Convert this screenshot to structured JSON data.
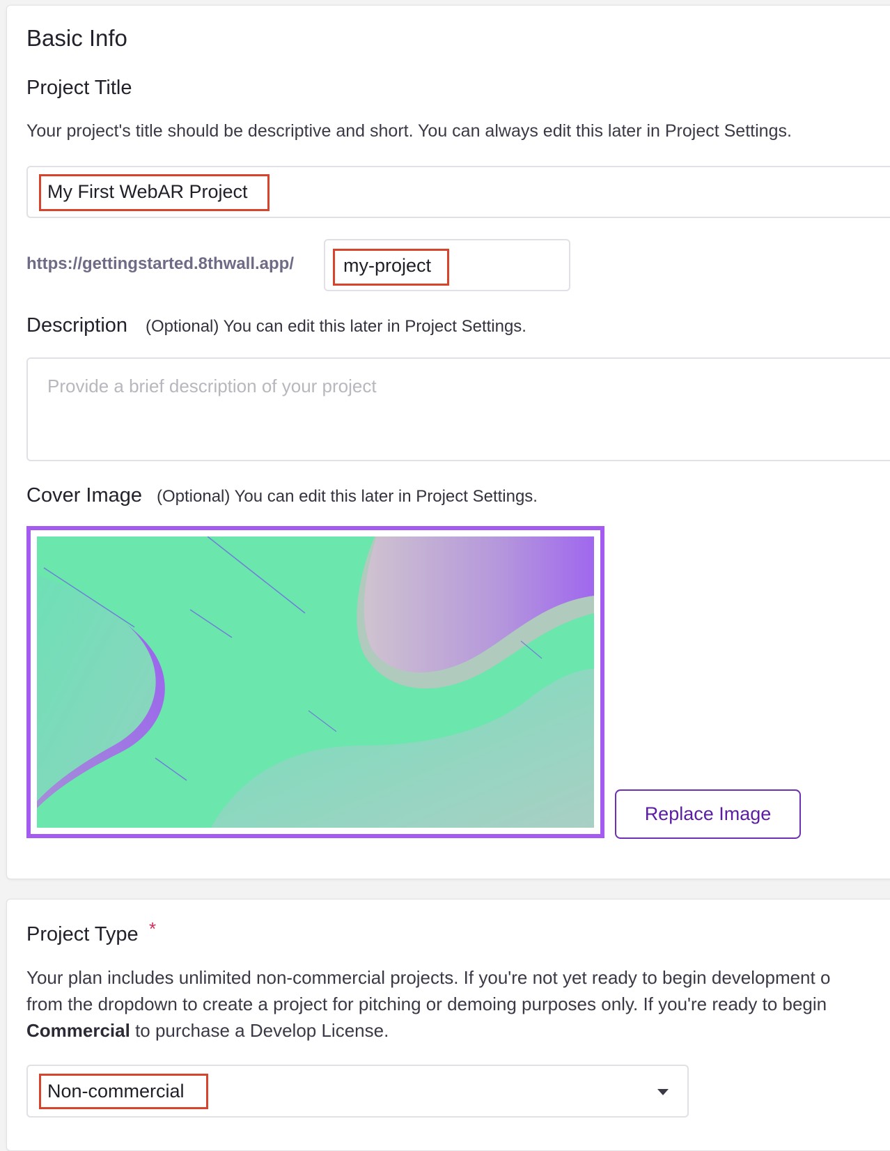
{
  "basic_info": {
    "section_title": "Basic Info",
    "project_title_label": "Project Title",
    "project_title_help": "Your project's title should be descriptive and short. You can always edit this later in Project Settings.",
    "project_title_value": "My First WebAR Project",
    "url_prefix": "https://gettingstarted.8thwall.app/",
    "url_slug_value": "my-project",
    "description_label": "Description",
    "description_optional": "(Optional) You can edit this later in Project Settings.",
    "description_placeholder": "Provide a brief description of your project",
    "cover_image_label": "Cover Image",
    "cover_image_optional": "(Optional) You can edit this later in Project Settings.",
    "replace_image_label": "Replace Image"
  },
  "project_type": {
    "label": "Project Type",
    "required_mark": "*",
    "help_line1": "Your plan includes unlimited non-commercial projects. If you're not yet ready to begin development o",
    "help_line2": "from the dropdown to create a project for pitching or demoing purposes only. If you're ready to begin",
    "help_bold": "Commercial",
    "help_line3_rest": " to purchase a Develop License.",
    "selected_value": "Non-commercial"
  },
  "colors": {
    "accent_purple": "#a45bf0",
    "button_purple": "#5b1ea3",
    "highlight_red": "#d8432c",
    "required_red": "#d12e5b"
  },
  "icons": {
    "dropdown": "caret-down-icon"
  }
}
